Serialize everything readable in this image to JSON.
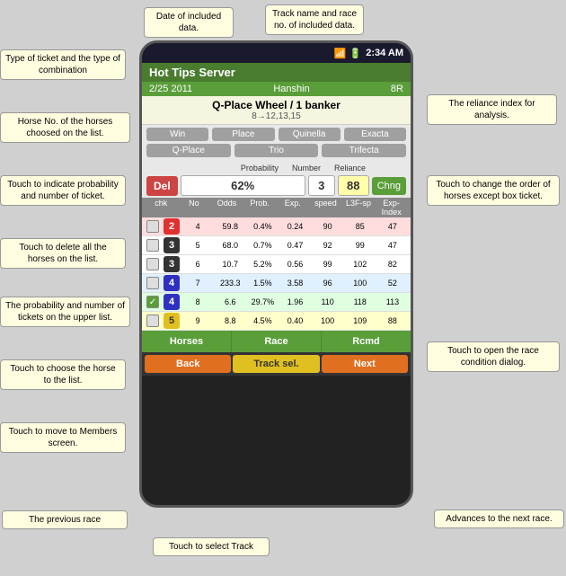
{
  "annotations": {
    "date_data": "Date of included\ndata.",
    "track_name": "Track name and race\nno. of included data.",
    "ticket_type": "Type of ticket and\nthe type of combination",
    "horse_no": "Horse No. of the horses\nchoosed on the list.",
    "reliance_index": "The reliance index\nfor analysis.",
    "probability": "Touch to indicate\nprobability\nand number of ticket.",
    "change_order": "Touch to change the\norder of horses\nexcept box ticket.",
    "delete_all": "Touch to delete all\nthe horses on the\nlist.",
    "prob_tickets": "The probability and\nnumber of tickets on\nthe upper list.",
    "choose_horse": "Touch to choose the\nhorse to the list.",
    "open_race": "Touch to open the\nrace condition dialog.",
    "move_members": "Touch to move to\nMembers screen.",
    "previous_race": "The previous race",
    "next_race": "Advances to the next\nrace.",
    "select_track": "Touch to select Track"
  },
  "status_bar": {
    "time": "2:34 AM",
    "icons": "📶📶🔋"
  },
  "app": {
    "title": "Hot Tips Server",
    "date": "2/25 2011",
    "track": "Hanshin",
    "race": "8R",
    "ticket_main": "Q-Place Wheel / 1 banker",
    "ticket_sub": "8→12,13,15"
  },
  "bet_types": {
    "row1": [
      "Win",
      "Place",
      "Quinella",
      "Exacta"
    ],
    "row2": [
      "Q-Place",
      "Trio",
      "Trifecta"
    ]
  },
  "controls": {
    "del_label": "Del",
    "probability": "62%",
    "number": "3",
    "reliance": "88",
    "chng_label": "Chng",
    "headers": [
      "Probability",
      "Number",
      "Reliance"
    ]
  },
  "table": {
    "columns": [
      "chk",
      "No",
      "Odds",
      "Prob.",
      "Exp.",
      "speed",
      "L3F-sp",
      "Exp-Index"
    ],
    "rows": [
      {
        "check": false,
        "num": "2",
        "color": "h-red",
        "row_color": "row-red",
        "odds": "4",
        "prob": "59.8",
        "exp": "0.4%",
        "speed": "0.24",
        "l3fsp": "90",
        "expidx": "85",
        "val8": "47"
      },
      {
        "check": false,
        "num": "3",
        "color": "h-black",
        "row_color": "row-white",
        "odds": "5",
        "prob": "68.0",
        "exp": "0.7%",
        "speed": "0.47",
        "l3fsp": "92",
        "expidx": "99",
        "val8": "47"
      },
      {
        "check": false,
        "num": "3",
        "color": "h-black",
        "row_color": "row-white",
        "odds": "6",
        "prob": "10.7",
        "exp": "5.2%",
        "speed": "0.56",
        "l3fsp": "99",
        "expidx": "102",
        "val8": "82"
      },
      {
        "check": false,
        "num": "4",
        "color": "h-blue",
        "row_color": "row-lightblue",
        "odds": "7",
        "prob": "233.3",
        "exp": "1.5%",
        "speed": "3.58",
        "l3fsp": "96",
        "expidx": "100",
        "val8": "52"
      },
      {
        "check": true,
        "num": "4",
        "color": "h-blue",
        "row_color": "row-green",
        "odds": "8",
        "prob": "6.6",
        "exp": "29.7%",
        "speed": "1.96",
        "l3fsp": "110",
        "expidx": "118",
        "val8": "113"
      },
      {
        "check": false,
        "num": "5",
        "color": "h-yellow",
        "row_color": "row-yellow",
        "odds": "9",
        "prob": "8.8",
        "exp": "4.5%",
        "speed": "0.40",
        "l3fsp": "100",
        "expidx": "109",
        "val8": "88"
      }
    ]
  },
  "bottom_nav": {
    "horses": "Horses",
    "race": "Race",
    "rcmd": "Rcmd"
  },
  "action_bar": {
    "back": "Back",
    "track": "Track sel.",
    "next": "Next"
  }
}
